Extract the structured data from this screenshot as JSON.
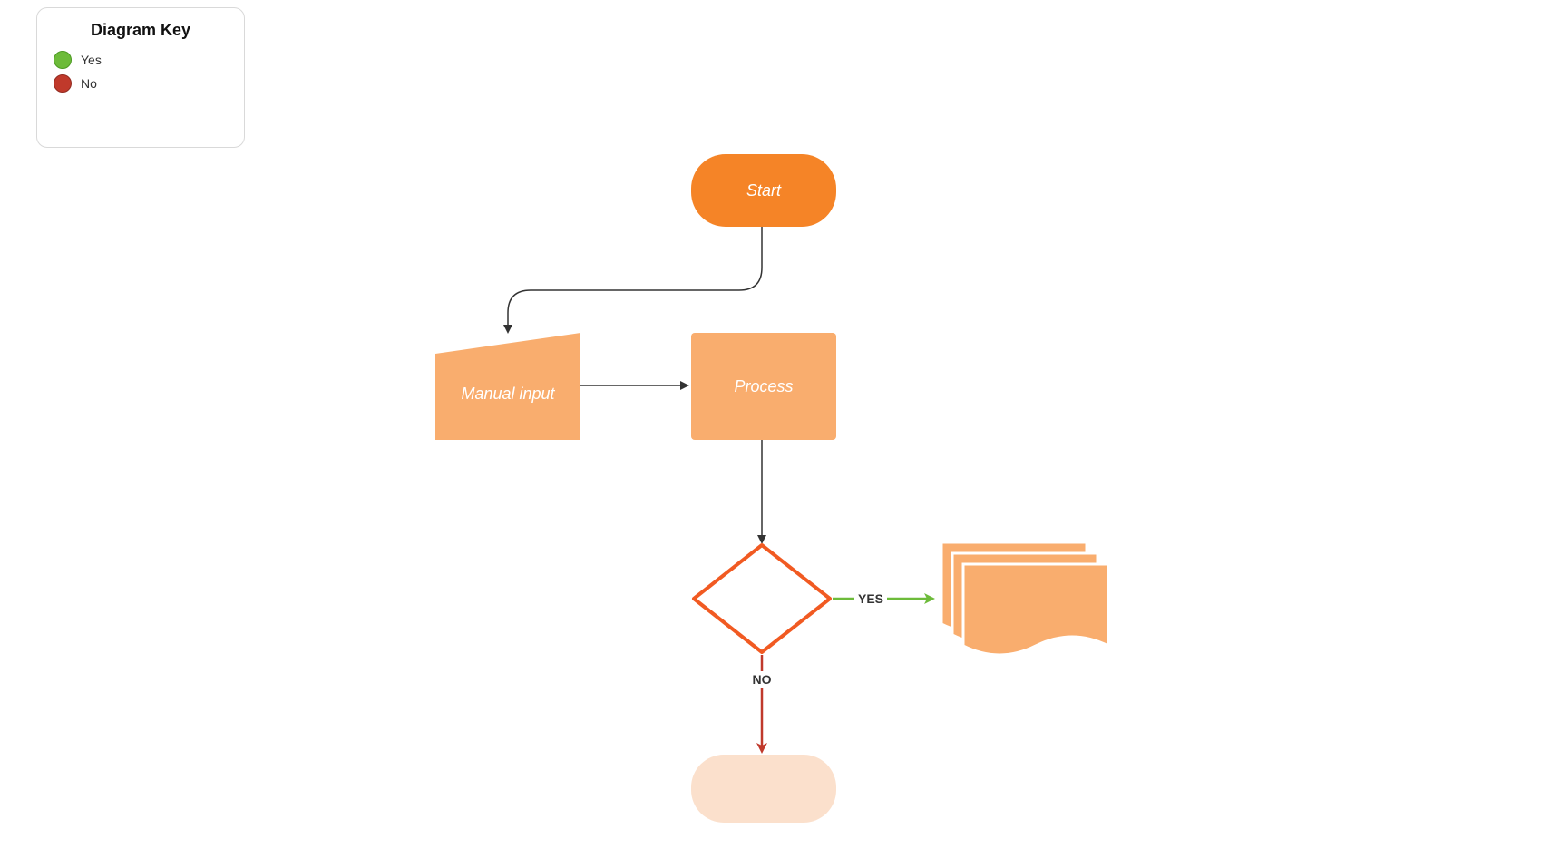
{
  "legend": {
    "title": "Diagram Key",
    "yesLabel": "Yes",
    "noLabel": "No"
  },
  "nodes": {
    "start": "Start",
    "manualInput": "Manual input",
    "process": "Process",
    "decision": "",
    "docs": "",
    "end": ""
  },
  "edges": {
    "yes": "YES",
    "no": "NO"
  },
  "colors": {
    "orangeFill": "#f58427",
    "orangeLight": "#f9ad6e",
    "orangePale": "#fbe0cc",
    "stroke": "#333333",
    "green": "#6dbb3a",
    "red": "#c0392b"
  }
}
